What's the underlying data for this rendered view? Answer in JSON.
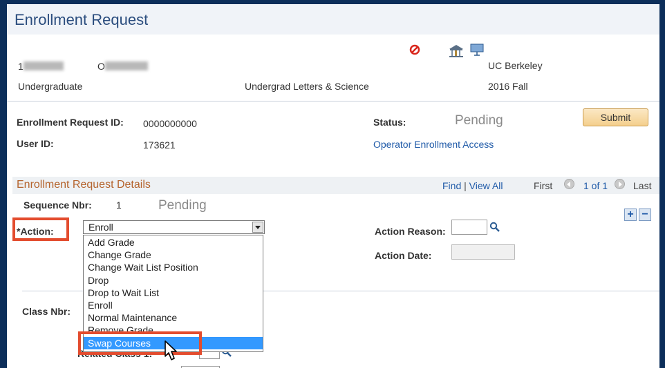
{
  "page": {
    "title": "Enrollment Request"
  },
  "header": {
    "institution": "UC Berkeley",
    "career": "Undergraduate",
    "program": "Undergrad Letters & Science",
    "term": "2016 Fall",
    "student_id_visible": "1",
    "name_visible": "O"
  },
  "request": {
    "id_label": "Enrollment Request ID:",
    "id_value": "0000000000",
    "status_label": "Status:",
    "status_value": "Pending",
    "submit_label": "Submit",
    "user_label": "User ID:",
    "user_value": "173621",
    "operator_link": "Operator Enrollment Access"
  },
  "details": {
    "section_title": "Enrollment Request Details",
    "find_label": "Find",
    "separator": "|",
    "view_all_label": "View All",
    "first_label": "First",
    "page_info": "1 of 1",
    "last_label": "Last",
    "seq_label": "Sequence Nbr:",
    "seq_value": "1",
    "seq_status": "Pending",
    "action_label": "*Action:",
    "action_value": "Enroll",
    "action_reason_label": "Action Reason:",
    "action_date_label": "Action Date:",
    "class_nbr_label": "Class Nbr:",
    "related_class_label": "Related Class 1:"
  },
  "dropdown": {
    "options": [
      "Add Grade",
      "Change Grade",
      "Change Wait List Position",
      "Drop",
      "Drop to Wait List",
      "Enroll",
      "Normal Maintenance",
      "Remove Grade",
      "Swap Courses"
    ],
    "highlighted": "Swap Courses"
  },
  "colors": {
    "title_text": "#2b4d7e",
    "section_title": "#b5642e",
    "link": "#1f5aa8",
    "highlight_box": "#e34c2e",
    "selected_option": "#3399ff",
    "outer_frame": "#0c2e5a"
  },
  "icons": {
    "prohibited": "prohibited-icon",
    "bank": "bank-icon",
    "presentation": "presentation-icon",
    "lookup": "magnifier-icon",
    "cursor": "mouse-pointer-icon"
  }
}
